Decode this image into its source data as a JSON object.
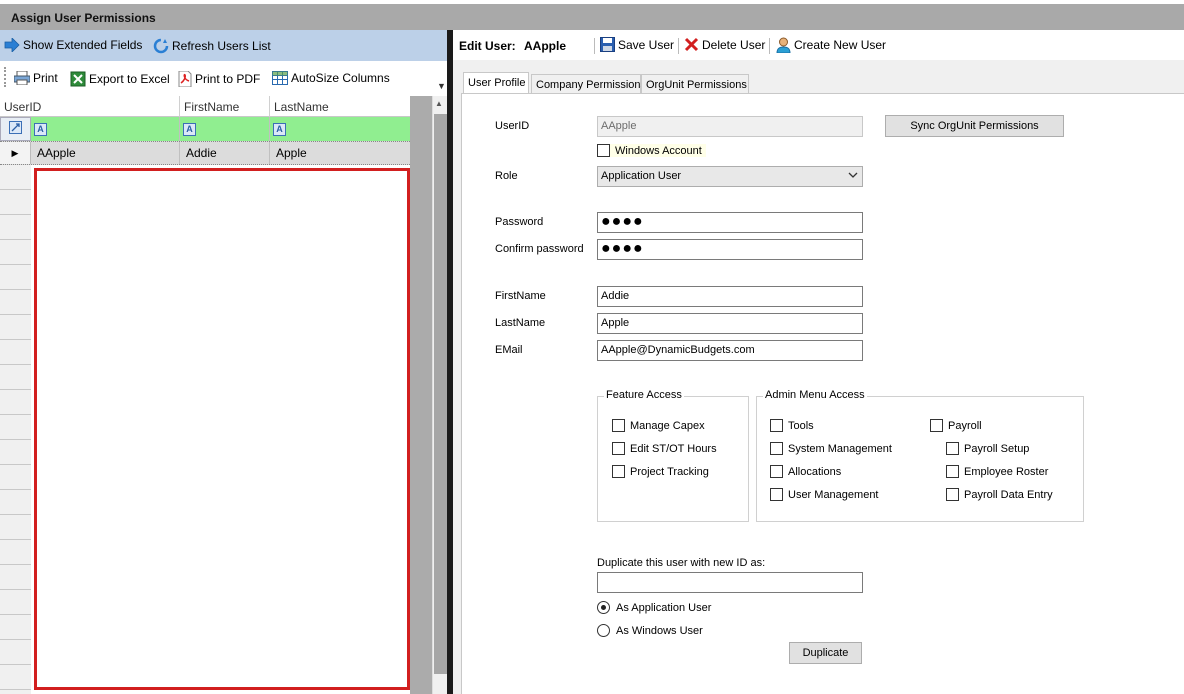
{
  "window": {
    "title": "Assign User Permissions"
  },
  "left_toolbar1": {
    "show_extended": "Show Extended Fields",
    "refresh_users": "Refresh Users List"
  },
  "left_toolbar2": {
    "print": "Print",
    "export_excel": "Export to Excel",
    "print_pdf": "Print to PDF",
    "autosize": "AutoSize Columns"
  },
  "grid": {
    "columns": [
      "UserID",
      "FirstName",
      "LastName"
    ],
    "rows": [
      {
        "userid": "AApple",
        "firstname": "Addie",
        "lastname": "Apple"
      }
    ]
  },
  "right_toolbar": {
    "edit_user_label": "Edit User:",
    "edit_user_value": "AApple",
    "save_user": "Save User",
    "delete_user": "Delete User",
    "create_user": "Create New User"
  },
  "tabs": [
    "User Profile",
    "Company Permissions",
    "OrgUnit Permissions"
  ],
  "form": {
    "userid_label": "UserID",
    "userid_value": "AApple",
    "sync_button": "Sync OrgUnit Permissions",
    "windows_account": "Windows Account",
    "role_label": "Role",
    "role_value": "Application User",
    "password_label": "Password",
    "password_value": "●●●●",
    "confirm_label": "Confirm password",
    "confirm_value": "●●●●",
    "firstname_label": "FirstName",
    "firstname_value": "Addie",
    "lastname_label": "LastName",
    "lastname_value": "Apple",
    "email_label": "EMail",
    "email_value": "AApple@DynamicBudgets.com"
  },
  "feature_access": {
    "title": "Feature Access",
    "items": [
      "Manage Capex",
      "Edit ST/OT Hours",
      "Project Tracking"
    ]
  },
  "admin_menu_access": {
    "title": "Admin Menu Access",
    "col1": [
      "Tools",
      "System Management",
      "Allocations",
      "User Management"
    ],
    "payroll": "Payroll",
    "payroll_sub": [
      "Payroll Setup",
      "Employee Roster",
      "Payroll Data Entry"
    ]
  },
  "duplicate": {
    "label": "Duplicate this user with new ID as:",
    "value": "",
    "as_app_user": "As Application User",
    "as_windows_user": "As Windows User",
    "button": "Duplicate",
    "selected": "As Application User"
  }
}
